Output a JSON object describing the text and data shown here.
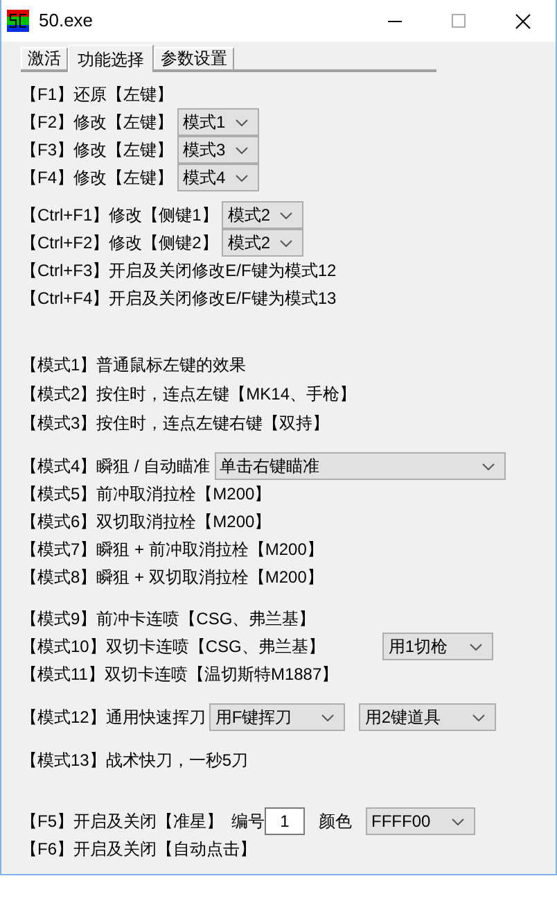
{
  "window": {
    "title": "50.exe"
  },
  "tabs": [
    {
      "label": "激活",
      "selected": false
    },
    {
      "label": "功能选择",
      "selected": true
    },
    {
      "label": "参数设置",
      "selected": false
    }
  ],
  "groups": [
    {
      "rows": [
        {
          "label": "【F1】还原【左键】"
        },
        {
          "label": "【F2】修改【左键】",
          "controls": [
            {
              "kind": "select",
              "value": "模式1"
            }
          ]
        },
        {
          "label": "【F3】修改【左键】",
          "controls": [
            {
              "kind": "select",
              "value": "模式3"
            }
          ]
        },
        {
          "label": "【F4】修改【左键】",
          "controls": [
            {
              "kind": "select",
              "value": "模式4"
            }
          ]
        }
      ]
    },
    {
      "rows": [
        {
          "label": "【Ctrl+F1】修改【侧键1】",
          "controls": [
            {
              "kind": "select",
              "value": "模式2"
            }
          ]
        },
        {
          "label": "【Ctrl+F2】修改【侧键2】",
          "controls": [
            {
              "kind": "select",
              "value": "模式2"
            }
          ]
        },
        {
          "label": "【Ctrl+F3】开启及关闭修改E/F键为模式12"
        },
        {
          "label": "【Ctrl+F4】开启及关闭修改E/F键为模式13"
        }
      ]
    },
    {
      "rows": [
        {
          "label": "【模式1】普通鼠标左键的效果"
        },
        {
          "label": "【模式2】按住时，连点左键【MK14、手枪】"
        },
        {
          "label": "【模式3】按住时，连点左键右键【双持】"
        }
      ]
    },
    {
      "rows": [
        {
          "label": "【模式4】瞬狙 / 自动瞄准",
          "controls": [
            {
              "kind": "select",
              "value": "单击右键瞄准"
            }
          ]
        },
        {
          "label": "【模式5】前冲取消拉栓【M200】"
        },
        {
          "label": "【模式6】双切取消拉栓【M200】"
        },
        {
          "label": "【模式7】瞬狙 + 前冲取消拉栓【M200】"
        },
        {
          "label": "【模式8】瞬狙 + 双切取消拉栓【M200】"
        }
      ]
    },
    {
      "rows": [
        {
          "label": "【模式9】前冲卡连喷【CSG、弗兰基】"
        },
        {
          "label": "【模式10】双切卡连喷【CSG、弗兰基】",
          "controls": [
            {
              "kind": "select",
              "value": "用1切枪"
            }
          ]
        },
        {
          "label": "【模式11】双切卡连喷【温切斯特M1887】"
        }
      ]
    },
    {
      "rows": [
        {
          "label": "【模式12】通用快速挥刀",
          "controls": [
            {
              "kind": "select",
              "value": "用F键挥刀"
            },
            {
              "kind": "select",
              "value": "用2键道具"
            }
          ]
        }
      ]
    },
    {
      "rows": [
        {
          "label": "【模式13】战术快刀，一秒5刀"
        }
      ]
    },
    {
      "rows": [
        {
          "label": "【F5】开启及关闭【准星】",
          "controls": [
            {
              "kind": "label",
              "value": "编号"
            },
            {
              "kind": "input",
              "value": "1"
            },
            {
              "kind": "label",
              "value": "颜色"
            },
            {
              "kind": "select",
              "value": "FFFF00"
            }
          ]
        },
        {
          "label": "【F6】开启及关闭【自动点击】"
        }
      ]
    }
  ]
}
